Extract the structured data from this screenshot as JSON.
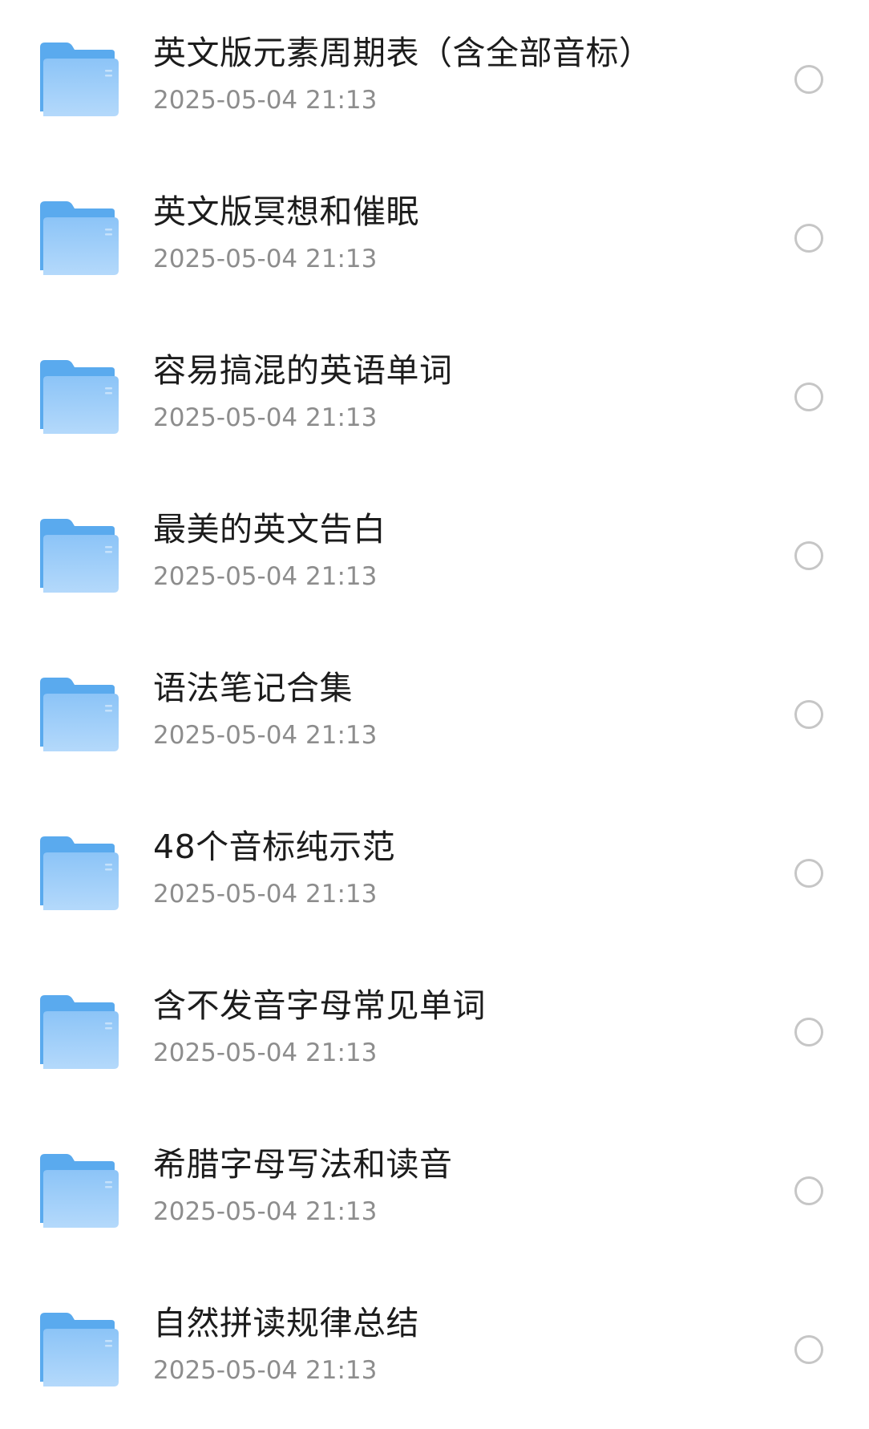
{
  "files": [
    {
      "name": "英文版元素周期表（含全部音标）",
      "date": "2025-05-04 21:13",
      "icon": "folder-icon",
      "selected": false
    },
    {
      "name": "英文版冥想和催眠",
      "date": "2025-05-04 21:13",
      "icon": "folder-icon",
      "selected": false
    },
    {
      "name": "容易搞混的英语单词",
      "date": "2025-05-04 21:13",
      "icon": "folder-icon",
      "selected": false
    },
    {
      "name": "最美的英文告白",
      "date": "2025-05-04 21:13",
      "icon": "folder-icon",
      "selected": false
    },
    {
      "name": "语法笔记合集",
      "date": "2025-05-04 21:13",
      "icon": "folder-icon",
      "selected": false
    },
    {
      "name": "48个音标纯示范",
      "date": "2025-05-04 21:13",
      "icon": "folder-icon",
      "selected": false
    },
    {
      "name": "含不发音字母常见单词",
      "date": "2025-05-04 21:13",
      "icon": "folder-icon",
      "selected": false
    },
    {
      "name": "希腊字母写法和读音",
      "date": "2025-05-04 21:13",
      "icon": "folder-icon",
      "selected": false
    },
    {
      "name": "自然拼读规律总结",
      "date": "2025-05-04 21:13",
      "icon": "folder-icon",
      "selected": false
    }
  ],
  "colors": {
    "folder_back": "#5aaaee",
    "folder_front_top": "#8cc4f7",
    "folder_front_bottom": "#b4d9fb",
    "title_text": "#1c1c1c",
    "date_text": "#8d8d8d",
    "radio_border": "#c6c6c6"
  }
}
